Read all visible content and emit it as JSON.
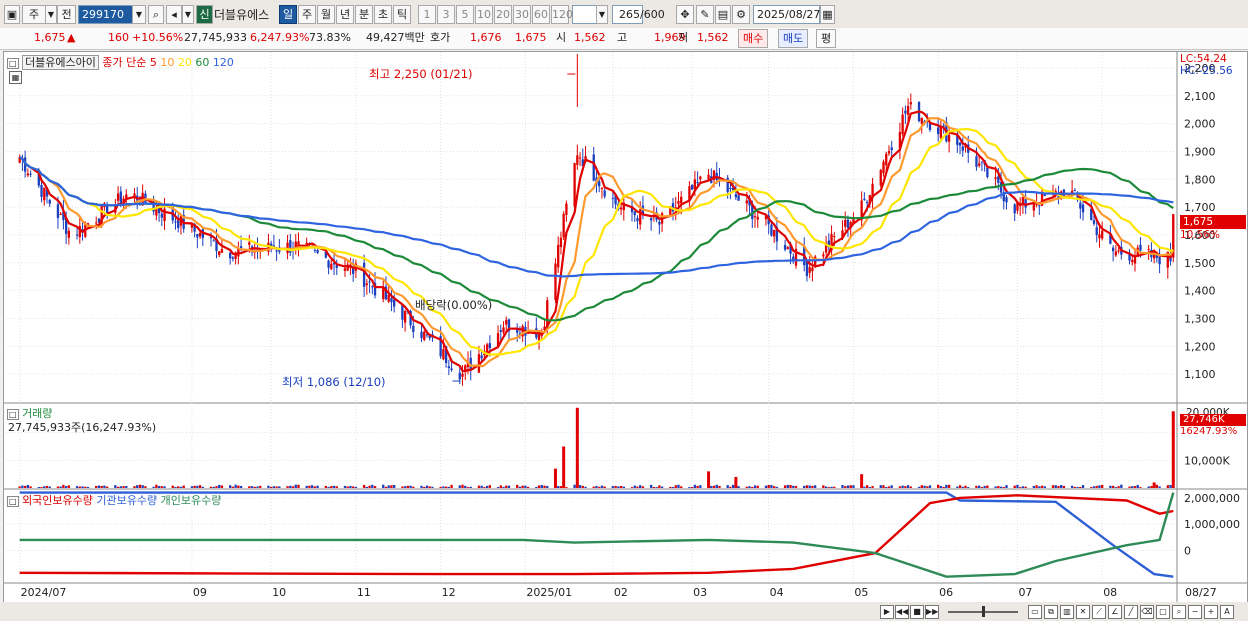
{
  "toolbar": {
    "type_label": "주",
    "prev_label": "전",
    "code": "299170",
    "stock_name": "더블유에스",
    "new_badge": "신",
    "periods": [
      "일",
      "주",
      "월",
      "년",
      "분",
      "초",
      "틱"
    ],
    "active_period": "일",
    "intervals": [
      "1",
      "3",
      "5",
      "10",
      "20",
      "30",
      "60",
      "120"
    ],
    "count": "265",
    "count_max": "/600",
    "date": "2025/08/27"
  },
  "quote": {
    "price": "1,675",
    "change": "160",
    "change_pct": "+10.56%",
    "volume": "27,745,933",
    "volume_pct": "6,247.93%",
    "turnover": "73.83%",
    "amount": "49,427백만",
    "bid_label": "호가",
    "bid1": "1,676",
    "bid2": "1,675",
    "open_label": "시",
    "open": "1,562",
    "high_label": "고",
    "high": "1,969",
    "low_label": "저",
    "low": "1,562",
    "buy_label": "매수",
    "sell_label": "매도",
    "eval_label": "평"
  },
  "price_panel": {
    "title": "더블유에스아이",
    "ma_label": "종가 단순",
    "lc": "LC:54.24",
    "hc": "HC:-25.56",
    "current_tag": "1,675",
    "current_pct": "10.56%",
    "high_annotation": "최고 2,250 (01/21)",
    "low_annotation": "최저 1,086 (12/10)",
    "dividend_annotation": "배당락(0.00%)"
  },
  "volume_panel": {
    "title": "거래량",
    "value": "27,745,933주(16,247.93%)",
    "axis_top": "20,000K",
    "tag1": "27,746K",
    "tag2": "16247.93%"
  },
  "holdings_panel": {
    "legend": [
      "외국인보유수량",
      "기관보유수량",
      "개인보유수량"
    ]
  },
  "x_ticks": [
    "2024/07",
    "09",
    "10",
    "11",
    "12",
    "2025/01",
    "02",
    "03",
    "04",
    "05",
    "06",
    "07",
    "08",
    "08/27"
  ],
  "colors": {
    "up": "#e00000",
    "down": "#1a3fbf",
    "ma5": "#e00000",
    "ma10": "#ff9a2e",
    "ma20": "#ffe600",
    "ma60": "#1d8a3a",
    "ma120": "#2f64e0",
    "foreign": "#e00000",
    "institution": "#2f5fd6",
    "individual": "#2e8b57"
  },
  "chart_data": {
    "type": "candlestick",
    "price_axis": {
      "ylim": [
        1000,
        2250
      ],
      "ticks": [
        1100,
        1200,
        1300,
        1400,
        1500,
        1600,
        1700,
        1800,
        1900,
        2000,
        2100,
        2200
      ]
    },
    "moving_averages": [
      {
        "name": "5",
        "period": 5
      },
      {
        "name": "10",
        "period": 10
      },
      {
        "name": "20",
        "period": 20
      },
      {
        "name": "60",
        "period": 60
      },
      {
        "name": "120",
        "period": 120
      }
    ],
    "close_keypoints": [
      {
        "date": "2024-07-01",
        "close": 1880
      },
      {
        "date": "2024-07-20",
        "close": 1600
      },
      {
        "date": "2024-08-10",
        "close": 1750
      },
      {
        "date": "2024-08-28",
        "close": 1650
      },
      {
        "date": "2024-09-15",
        "close": 1540
      },
      {
        "date": "2024-10-10",
        "close": 1560
      },
      {
        "date": "2024-11-01",
        "close": 1470
      },
      {
        "date": "2024-11-20",
        "close": 1300
      },
      {
        "date": "2024-12-10",
        "close": 1100
      },
      {
        "date": "2024-12-25",
        "close": 1280
      },
      {
        "date": "2025-01-08",
        "close": 1250
      },
      {
        "date": "2025-01-21",
        "close": 1900
      },
      {
        "date": "2025-02-05",
        "close": 1700
      },
      {
        "date": "2025-02-20",
        "close": 1640
      },
      {
        "date": "2025-03-10",
        "close": 1820
      },
      {
        "date": "2025-03-30",
        "close": 1650
      },
      {
        "date": "2025-04-15",
        "close": 1480
      },
      {
        "date": "2025-05-05",
        "close": 1700
      },
      {
        "date": "2025-05-22",
        "close": 2060
      },
      {
        "date": "2025-06-10",
        "close": 1930
      },
      {
        "date": "2025-06-30",
        "close": 1700
      },
      {
        "date": "2025-07-20",
        "close": 1760
      },
      {
        "date": "2025-08-05",
        "close": 1540
      },
      {
        "date": "2025-08-26",
        "close": 1515
      },
      {
        "date": "2025-08-27",
        "close": 1675
      }
    ],
    "volume_axis": {
      "ylim": [
        0,
        30000
      ],
      "unit": "K",
      "ticks": [
        10000,
        20000
      ]
    },
    "volume_spikes": [
      {
        "date": "2025-01-13",
        "value": 7000
      },
      {
        "date": "2025-01-16",
        "value": 15000
      },
      {
        "date": "2025-01-21",
        "value": 29000
      },
      {
        "date": "2025-03-10",
        "value": 6000
      },
      {
        "date": "2025-03-20",
        "value": 4000
      },
      {
        "date": "2025-05-05",
        "value": 5000
      },
      {
        "date": "2025-08-20",
        "value": 2000
      },
      {
        "date": "2025-08-27",
        "value": 27746
      }
    ],
    "holdings_axis": {
      "ticks": [
        0,
        1000000,
        2000000
      ]
    }
  }
}
